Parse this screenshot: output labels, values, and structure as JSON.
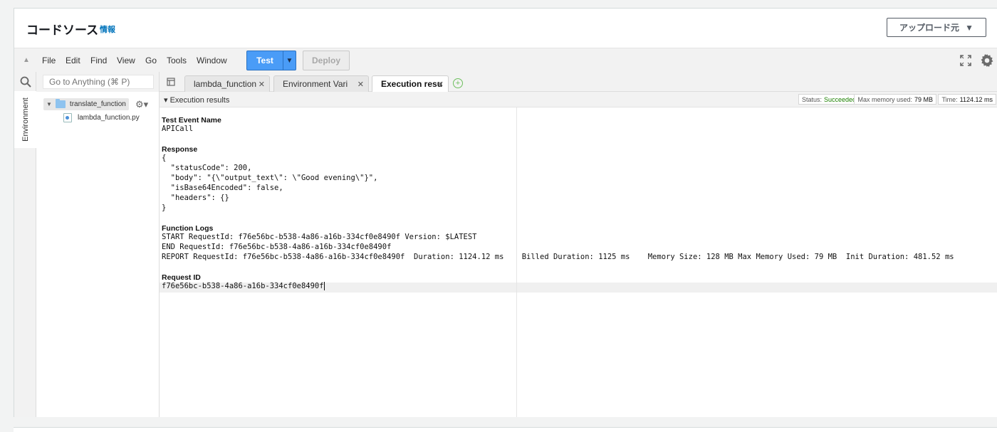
{
  "header": {
    "title": "コードソース",
    "info_link": "情報",
    "upload_button": "アップロード元"
  },
  "menu": {
    "items": [
      "File",
      "Edit",
      "Find",
      "View",
      "Go",
      "Tools",
      "Window"
    ],
    "test_button": "Test",
    "deploy_button": "Deploy"
  },
  "sidebar": {
    "environment_tab": "Environment",
    "goto_placeholder": "Go to Anything (⌘ P)",
    "folder": "translate_function",
    "file": "lambda_function.py"
  },
  "tabs": [
    {
      "label": "lambda_function",
      "active": false
    },
    {
      "label": "Environment Vari",
      "active": false
    },
    {
      "label": "Execution results",
      "active": true
    }
  ],
  "results": {
    "title": "Execution results",
    "status_label": "Status:",
    "status_value": "Succeeded",
    "memory_label": "Max memory used:",
    "memory_value": "79 MB",
    "time_label": "Time:",
    "time_value": "1124.12 ms",
    "colors": {
      "success": "#1d8102",
      "primary": "#4a9cf7"
    }
  },
  "output": {
    "event_title": "Test Event Name",
    "event_name": "APICall",
    "response_title": "Response",
    "response_lines": [
      "{",
      "  \"statusCode\": 200,",
      "  \"body\": \"{\\\"output_text\\\": \\\"Good evening\\\"}\",",
      "  \"isBase64Encoded\": false,",
      "  \"headers\": {}",
      "}"
    ],
    "logs_title": "Function Logs",
    "log_lines": [
      "START RequestId: f76e56bc-b538-4a86-a16b-334cf0e8490f Version: $LATEST",
      "END RequestId: f76e56bc-b538-4a86-a16b-334cf0e8490f",
      "REPORT RequestId: f76e56bc-b538-4a86-a16b-334cf0e8490f  Duration: 1124.12 ms    Billed Duration: 1125 ms    Memory Size: 128 MB Max Memory Used: 79 MB  Init Duration: 481.52 ms"
    ],
    "request_id_title": "Request ID",
    "request_id": "f76e56bc-b538-4a86-a16b-334cf0e8490f"
  }
}
